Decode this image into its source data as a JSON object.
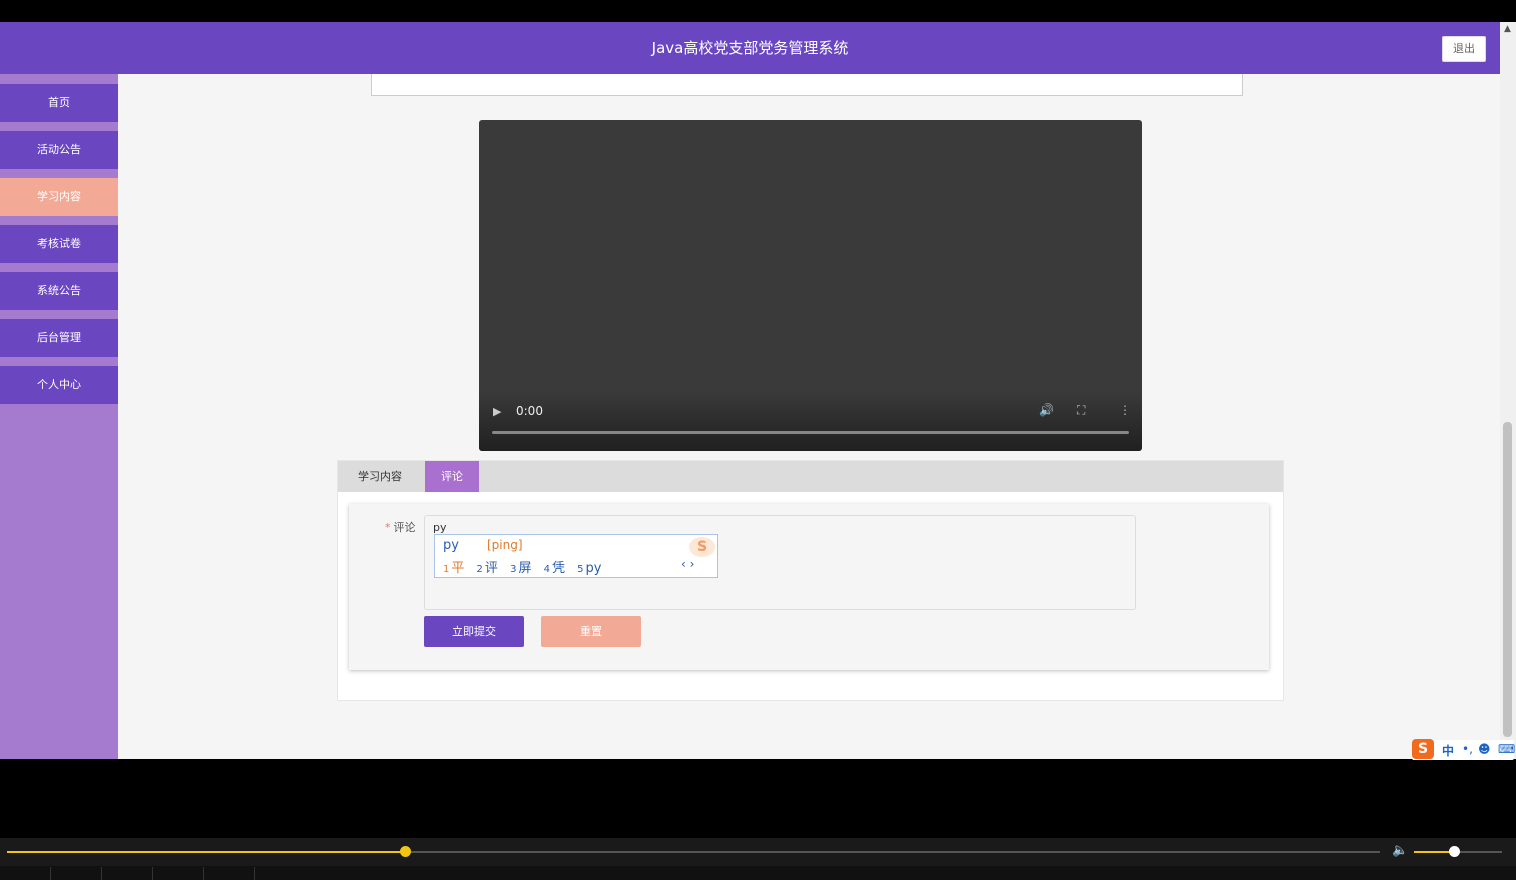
{
  "header": {
    "title": "Java高校党支部党务管理系统",
    "logout_label": "退出"
  },
  "sidebar": {
    "items": [
      {
        "label": "首页"
      },
      {
        "label": "活动公告"
      },
      {
        "label": "学习内容",
        "active": true
      },
      {
        "label": "考核试卷"
      },
      {
        "label": "系统公告"
      },
      {
        "label": "后台管理"
      },
      {
        "label": "个人中心"
      }
    ]
  },
  "video": {
    "time": "0:00"
  },
  "tabs": [
    {
      "label": "学习内容"
    },
    {
      "label": "评论",
      "active": true
    }
  ],
  "form": {
    "required_mark": "*",
    "comment_label": "评论",
    "comment_value": "py",
    "submit_label": "立即提交",
    "reset_label": "重置"
  },
  "ime": {
    "code": "py",
    "pinyin": "[ping]",
    "candidates": [
      {
        "index": "1",
        "text": "平"
      },
      {
        "index": "2",
        "text": "评"
      },
      {
        "index": "3",
        "text": "屏"
      },
      {
        "index": "4",
        "text": "凭"
      },
      {
        "index": "5",
        "text": "py"
      }
    ],
    "status": {
      "logo": "S",
      "mode": "中",
      "punctuation": "•,",
      "emoji": "☻",
      "keyboard": "⌨"
    }
  },
  "player": {
    "seek_fraction": 0.29,
    "volume_fraction": 0.45
  },
  "colors": {
    "primary": "#6b46c1",
    "sidebar_bg": "#a57bd0",
    "active": "#f2aa97",
    "tab_active": "#a970cf",
    "seek": "#f2c511"
  }
}
